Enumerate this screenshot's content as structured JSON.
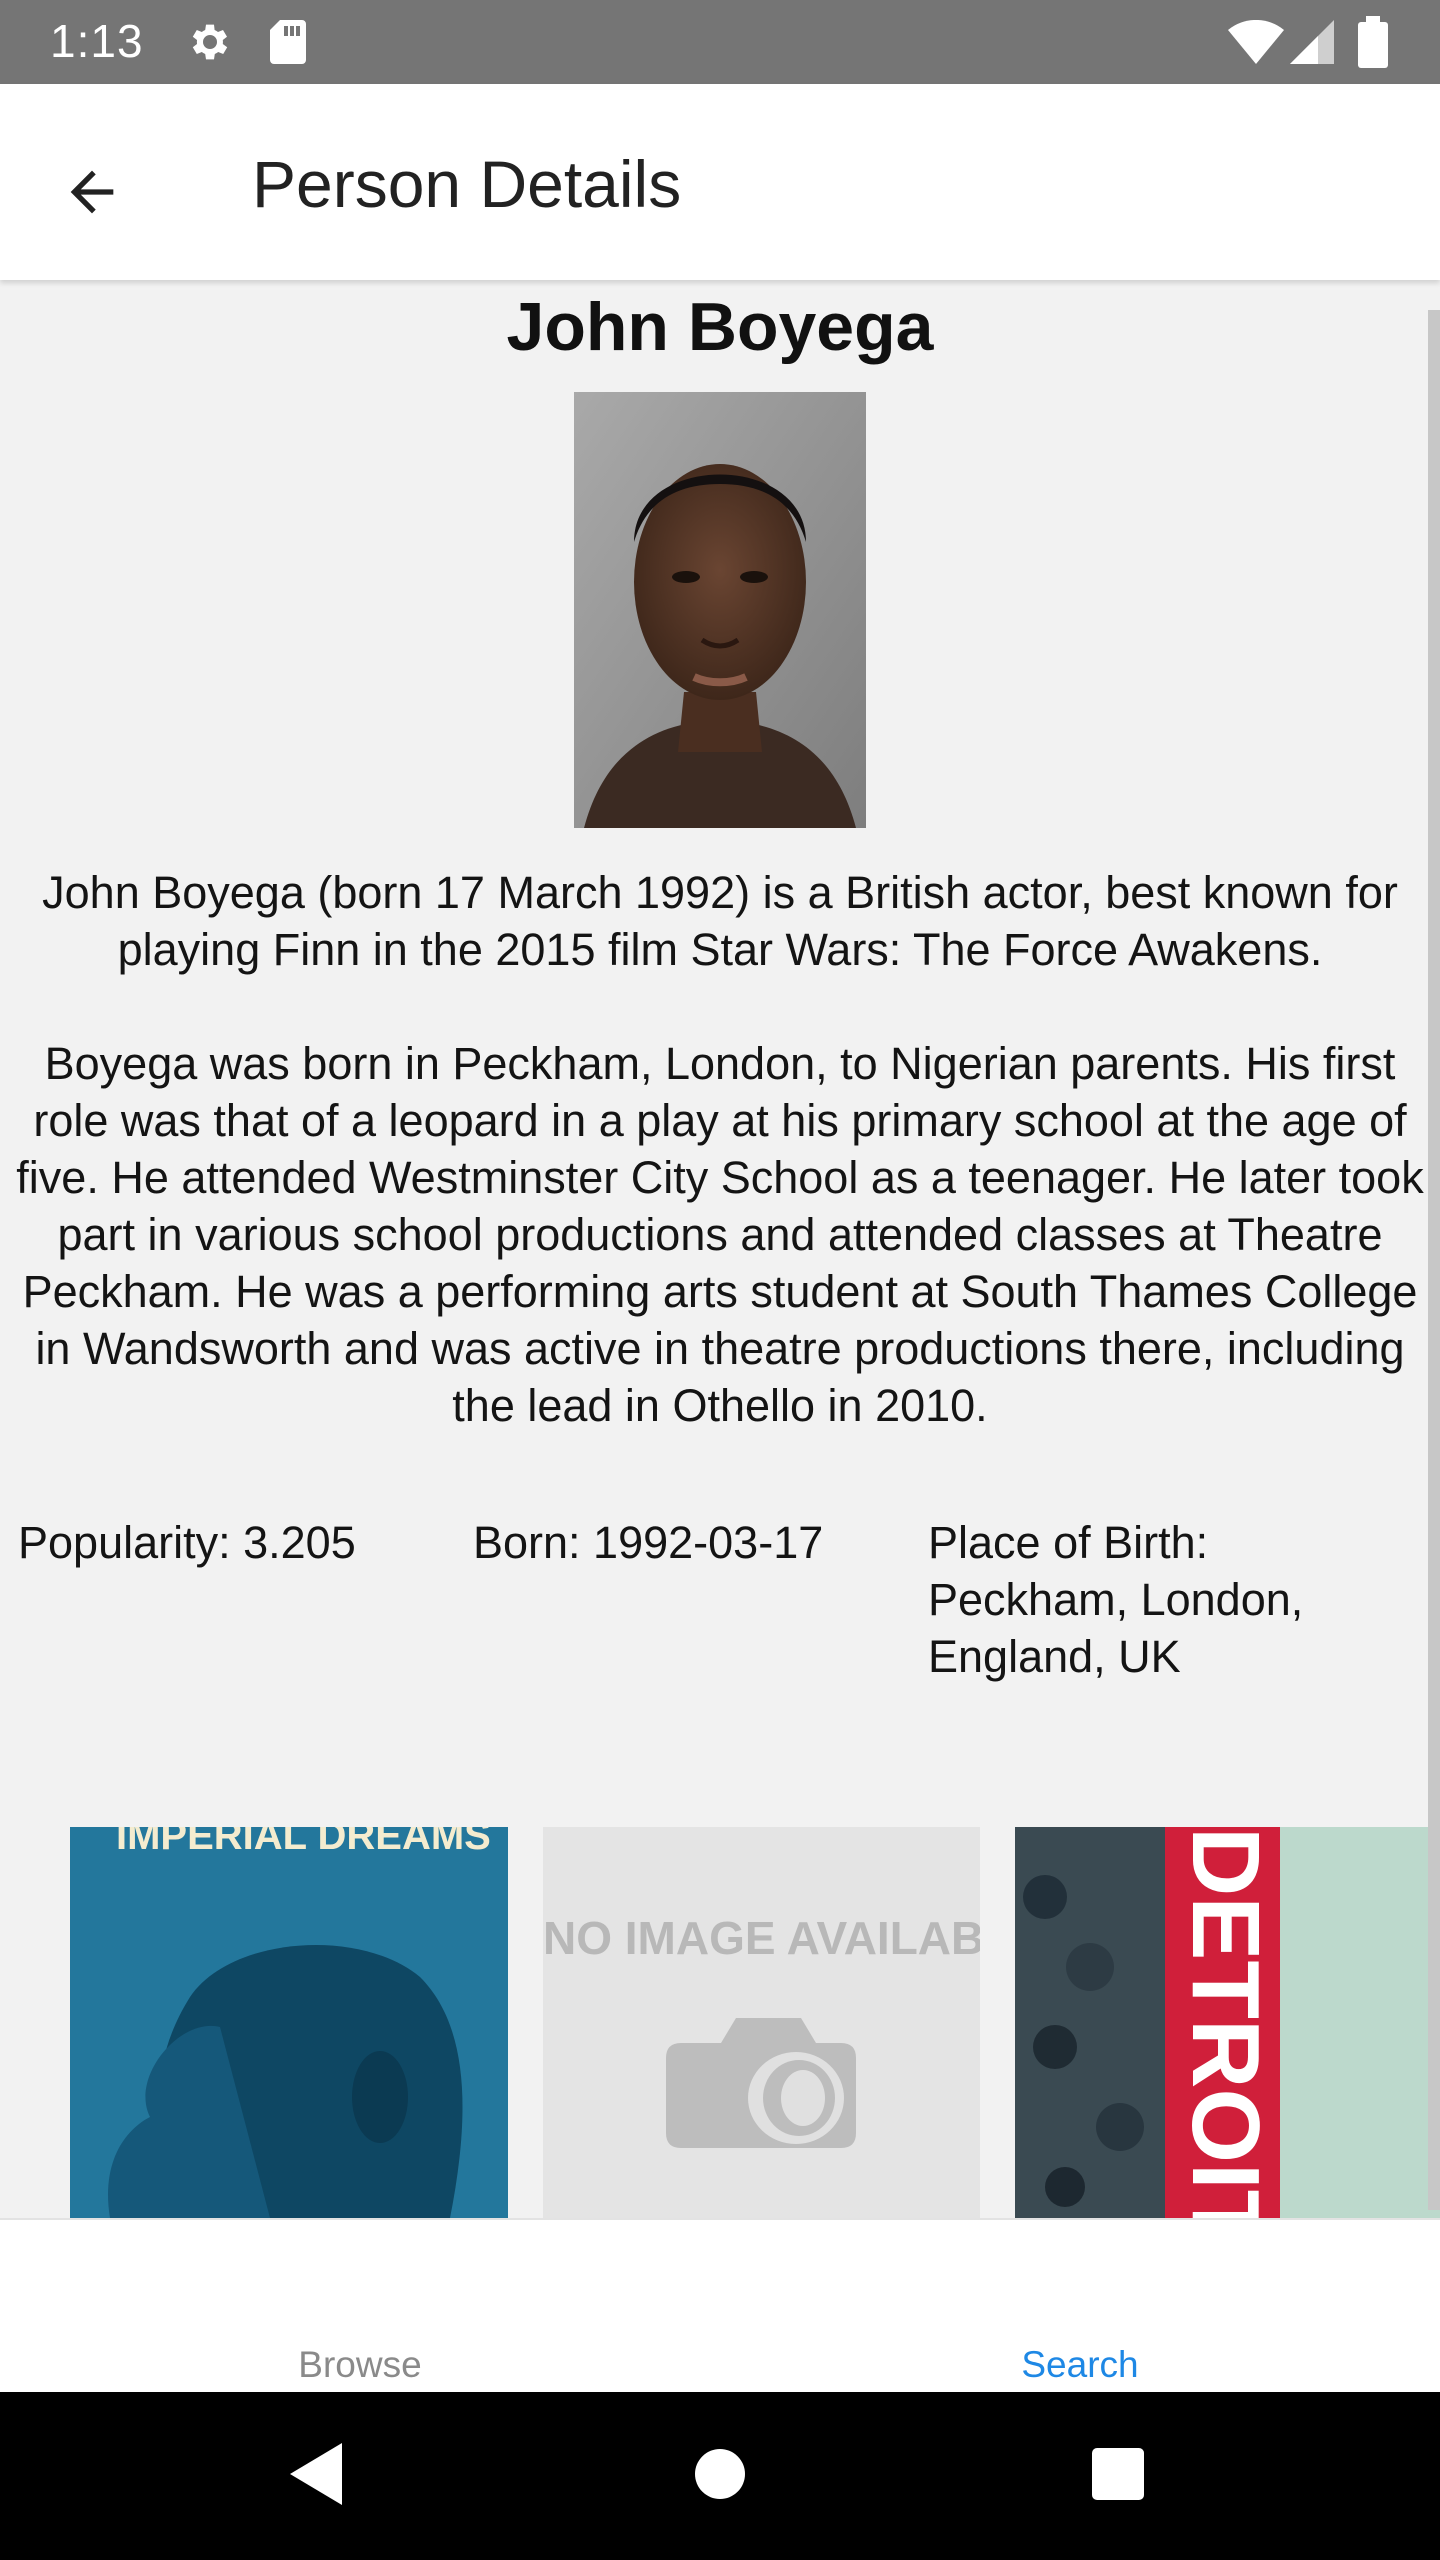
{
  "status_bar": {
    "time": "1:13",
    "icons": [
      "settings-icon",
      "sd-card-icon",
      "wifi-icon",
      "signal-icon",
      "battery-icon"
    ]
  },
  "app_bar": {
    "title": "Person Details",
    "back_icon": "arrow-back-icon"
  },
  "person": {
    "name": "John Boyega",
    "bio": [
      "John Boyega (born 17 March 1992) is a British actor, best known for playing Finn in the 2015 film Star Wars: The Force Awakens.",
      "Boyega was born in Peckham, London, to Nigerian parents. His first role was that of a leopard in a play at his primary school at the age of five. He attended Westminster City School as a teenager. He later took part in various school productions and attended classes at Theatre Peckham. He was a performing arts student at South Thames College in Wandsworth and was active in theatre productions there, including the lead in Othello in 2010."
    ],
    "popularity": "Popularity: 3.205",
    "born": "Born: 1992-03-17",
    "place_of_birth": "Place of Birth: Peckham, London, England, UK"
  },
  "posters": [
    {
      "title_text": "IMPERIAL DREAMS"
    },
    {
      "title_text": "NO IMAGE AVAILABLE"
    },
    {
      "title_text": "DETROIT"
    }
  ],
  "bottom_nav": {
    "items": [
      {
        "label": "Browse",
        "active": false
      },
      {
        "label": "Search",
        "active": true
      }
    ],
    "active_color": "#1e88e5",
    "inactive_color": "#8a8a8a"
  },
  "system_nav": {
    "buttons": [
      "back-triangle-icon",
      "home-circle-icon",
      "recents-square-icon"
    ]
  },
  "colors": {
    "status_bar": "#757575",
    "app_bar": "#ffffff",
    "content_bg": "#f2f2f2"
  }
}
